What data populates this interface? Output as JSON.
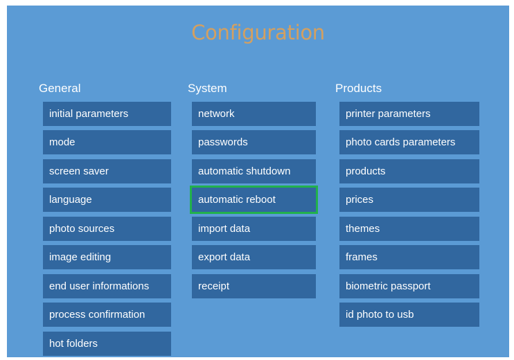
{
  "title": "Configuration",
  "columns": [
    {
      "header": "General",
      "items": [
        "initial parameters",
        "mode",
        "screen saver",
        "language",
        "photo sources",
        "image editing",
        "end user informations",
        "process confirmation",
        "hot folders"
      ]
    },
    {
      "header": "System",
      "items": [
        "network",
        "passwords",
        "automatic shutdown",
        "automatic reboot",
        "import data",
        "export data",
        "receipt"
      ],
      "selected_item": "automatic reboot"
    },
    {
      "header": "Products",
      "items": [
        "printer parameters",
        "photo cards parameters",
        "products",
        "prices",
        "themes",
        "frames",
        "biometric passport",
        "id photo to usb"
      ]
    }
  ],
  "colors": {
    "background": "#5b9bd5",
    "button": "#31679f",
    "title": "#d4a060",
    "selection_outline": "#22b14c"
  }
}
